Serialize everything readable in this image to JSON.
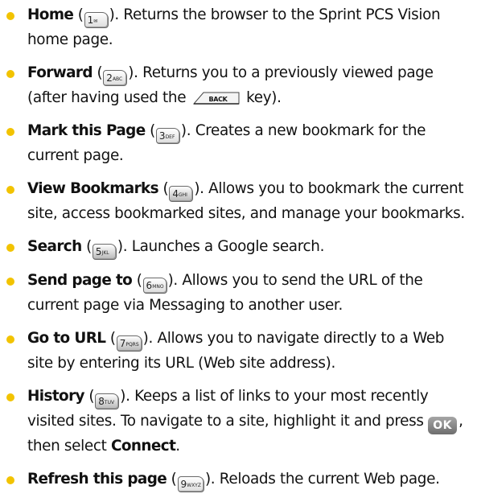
{
  "items": [
    {
      "term": "Home",
      "key_num": "1",
      "key_sub": "✉",
      "pre": " (",
      "post": "). Returns the browser to the Sprint PCS Vision home page."
    },
    {
      "term": "Forward",
      "key_num": "2",
      "key_sub": "ABC",
      "pre": " (",
      "mid": "). Returns you to a previously viewed page (after having used the ",
      "back_label": "BACK",
      "post": " key)."
    },
    {
      "term": "Mark this Page",
      "key_num": "3",
      "key_sub": "DEF",
      "pre": " (",
      "post": "). Creates a new bookmark for the current page."
    },
    {
      "term": "View Bookmarks",
      "key_num": "4",
      "key_sub": "GHI",
      "pre": " (",
      "post": "). Allows you to bookmark the current site, access bookmarked sites, and manage your bookmarks."
    },
    {
      "term": "Search",
      "key_num": "5",
      "key_sub": "JKL",
      "pre": " (",
      "post": "). Launches a Google search."
    },
    {
      "term": "Send page to",
      "key_num": "6",
      "key_sub": "MNO",
      "pre": " (",
      "post": "). Allows you to send the URL of the current page via Messaging to another user."
    },
    {
      "term": "Go to URL",
      "key_num": "7",
      "key_sub": "PQRS",
      "pre": " (",
      "post": "). Allows you to navigate directly to a Web site by entering its URL (Web site address)."
    },
    {
      "term": "History",
      "key_num": "8",
      "key_sub": "TUV",
      "pre": " (",
      "mid": "). Keeps a list of links to your most recently visited sites. To navigate to a site, highlight it and press ",
      "ok_label": "OK",
      "mid2": ", then select ",
      "term2": "Connect",
      "post": "."
    },
    {
      "term": "Refresh this page",
      "key_num": "9",
      "key_sub": "WXYZ",
      "pre": " (",
      "post": "). Reloads the current Web page."
    }
  ],
  "colors": {
    "bullet": "#f2c300",
    "text": "#111111"
  }
}
